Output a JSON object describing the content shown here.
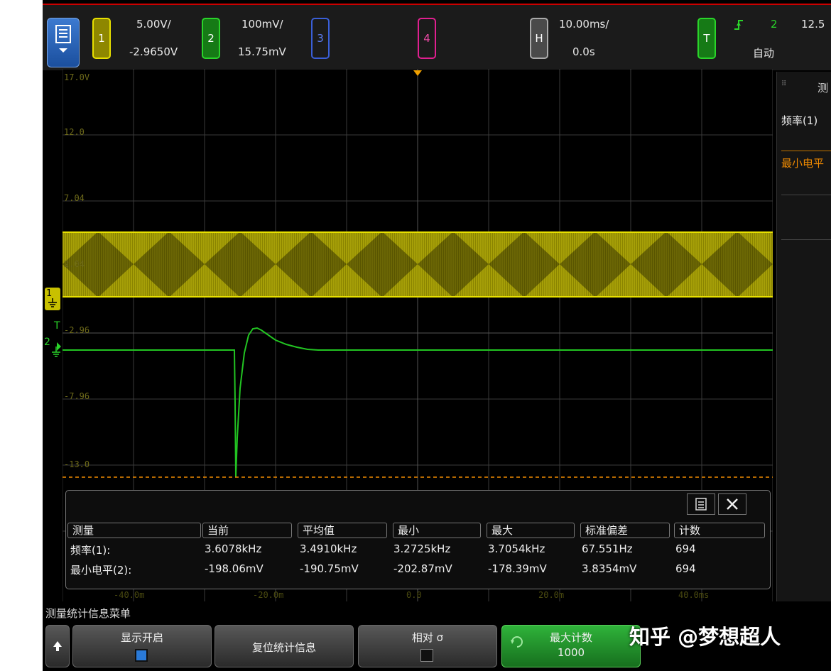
{
  "header": {
    "ch1": {
      "label": "1",
      "scale": "5.00V/",
      "offset": "-2.9650V",
      "color": "#e8e000"
    },
    "ch2": {
      "label": "2",
      "scale": "100mV/",
      "offset": "15.75mV",
      "color": "#20c020"
    },
    "ch3": {
      "label": "3",
      "color": "#3a5fd8"
    },
    "ch4": {
      "label": "4",
      "color": "#e02090"
    },
    "horizontal": {
      "label": "H",
      "scale": "10.00ms/",
      "delay": "0.0s"
    },
    "trigger": {
      "label": "T",
      "source": "2",
      "level": "12.5",
      "mode": "自动"
    }
  },
  "grid": {
    "volt_labels": [
      "17.0V",
      "12.0",
      "7.04",
      "2.04",
      "-2.96",
      "-7.96",
      "-13.0"
    ],
    "time_labels": [
      "-40.0m",
      "-20.0m",
      "0.0",
      "20.0m",
      "40.0ms"
    ],
    "ch1_marker": "1",
    "ch2_marker": "2",
    "trigger_marker": "T"
  },
  "right_panel": {
    "title": "测",
    "row1": "频率(1)",
    "row2": "最小电平"
  },
  "measurement_table": {
    "headers": [
      "测量",
      "当前",
      "平均值",
      "最小",
      "最大",
      "标准偏差",
      "计数"
    ],
    "rows": [
      {
        "name": "频率(1):",
        "current": "3.6078kHz",
        "mean": "3.4910kHz",
        "min": "3.2725kHz",
        "max": "3.7054kHz",
        "std": "67.551Hz",
        "count": "694"
      },
      {
        "name": "最小电平(2):",
        "current": "-198.06mV",
        "mean": "-190.75mV",
        "min": "-202.87mV",
        "max": "-178.39mV",
        "std": "3.8354mV",
        "count": "694"
      }
    ]
  },
  "menu": {
    "title": "测量统计信息菜单",
    "softkeys": [
      {
        "label": "显示开启"
      },
      {
        "label": "复位统计信息"
      },
      {
        "label": "相对 σ"
      },
      {
        "label": "最大计数",
        "value": "1000"
      }
    ]
  },
  "watermark": "知乎 @梦想超人",
  "icons": {
    "menu": "list-menu-icon",
    "close": "close-icon",
    "up": "up-arrow-icon",
    "trigger_slope": "rising-edge-icon"
  }
}
